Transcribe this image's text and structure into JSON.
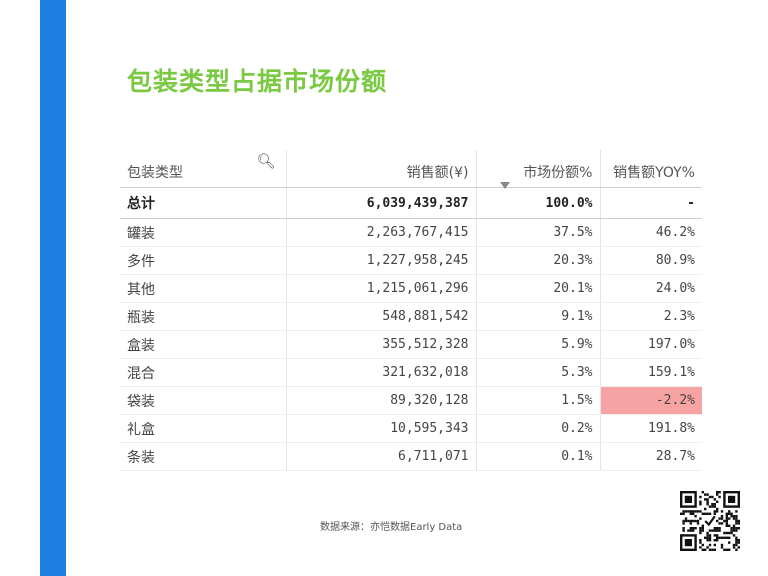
{
  "colors": {
    "accent_bar": "#1e7fe0",
    "title": "#7ac943",
    "negative_highlight": "#f7a3a3"
  },
  "title": "包装类型占据市场份额",
  "table": {
    "headers": [
      "包装类型",
      "销售额(¥)",
      "市场份额%",
      "销售额YOY%"
    ],
    "total": {
      "name": "总计",
      "sales": "6,039,439,387",
      "share": "100.0%",
      "yoy": "-"
    },
    "rows": [
      {
        "name": "罐装",
        "sales": "2,263,767,415",
        "share": "37.5%",
        "yoy": "46.2%",
        "highlight": false
      },
      {
        "name": "多件",
        "sales": "1,227,958,245",
        "share": "20.3%",
        "yoy": "80.9%",
        "highlight": false
      },
      {
        "name": "其他",
        "sales": "1,215,061,296",
        "share": "20.1%",
        "yoy": "24.0%",
        "highlight": false
      },
      {
        "name": "瓶装",
        "sales": "548,881,542",
        "share": "9.1%",
        "yoy": "2.3%",
        "highlight": false
      },
      {
        "name": "盒装",
        "sales": "355,512,328",
        "share": "5.9%",
        "yoy": "197.0%",
        "highlight": false
      },
      {
        "name": "混合",
        "sales": "321,632,018",
        "share": "5.3%",
        "yoy": "159.1%",
        "highlight": false
      },
      {
        "name": "袋装",
        "sales": "89,320,128",
        "share": "1.5%",
        "yoy": "-2.2%",
        "highlight": true
      },
      {
        "name": "礼盒",
        "sales": "10,595,343",
        "share": "0.2%",
        "yoy": "191.8%",
        "highlight": false
      },
      {
        "name": "条装",
        "sales": "6,711,071",
        "share": "0.1%",
        "yoy": "28.7%",
        "highlight": false
      }
    ]
  },
  "icons": {
    "search": "search-icon",
    "qr": "qr-code-icon"
  },
  "source_note": "数据来源：亦恺数据Early Data"
}
